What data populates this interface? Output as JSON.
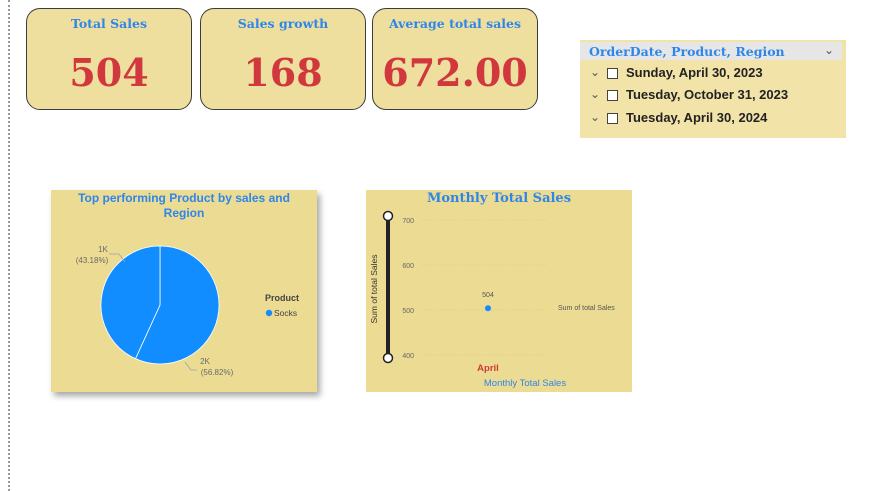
{
  "kpis": [
    {
      "title": "Total Sales",
      "value": "504"
    },
    {
      "title": "Sales growth",
      "value": "168"
    },
    {
      "title": "Average total sales",
      "value": "672.00"
    }
  ],
  "slicer": {
    "title": "OrderDate, Product, Region",
    "items": [
      {
        "label": "Sunday, April 30, 2023",
        "checked": false
      },
      {
        "label": "Tuesday, October 31, 2023",
        "checked": false
      },
      {
        "label": "Tuesday, April 30, 2024",
        "checked": false
      }
    ]
  },
  "pie_chart": {
    "title": "Top performing Product by sales and Region",
    "legend_title": "Product",
    "legend_item": "Socks",
    "label_small_value": "1K",
    "label_small_pct": "(43.18%)",
    "label_large_value": "2K",
    "label_large_pct": "(56.82%)"
  },
  "line_chart": {
    "title": "Monthly Total Sales",
    "y_axis_label": "Sum of total Sales",
    "x_axis_label": "Monthly Total Sales",
    "category_label": "April",
    "legend_label": "Sum of  total Sales",
    "y_ticks": [
      "700",
      "600",
      "500",
      "400"
    ],
    "point_label": "504"
  },
  "chart_data": [
    {
      "type": "pie",
      "title": "Top performing Product by sales and Region",
      "legend": [
        "Socks"
      ],
      "slices": [
        {
          "label": "1K",
          "value": 1000,
          "percent": 43.18
        },
        {
          "label": "2K",
          "value": 2000,
          "percent": 56.82
        }
      ]
    },
    {
      "type": "scatter",
      "title": "Monthly Total Sales",
      "xlabel": "Monthly Total Sales",
      "ylabel": "Sum of total Sales",
      "categories": [
        "April"
      ],
      "series": [
        {
          "name": "Sum of  total Sales",
          "values": [
            504
          ]
        }
      ],
      "ylim": [
        400,
        700
      ],
      "yticks": [
        400,
        500,
        600,
        700
      ]
    }
  ],
  "colors": {
    "card_bg": "#efdf9f",
    "title_blue": "#2f86ea",
    "value_red": "#d0383e",
    "pie_blue": "#118dff"
  }
}
